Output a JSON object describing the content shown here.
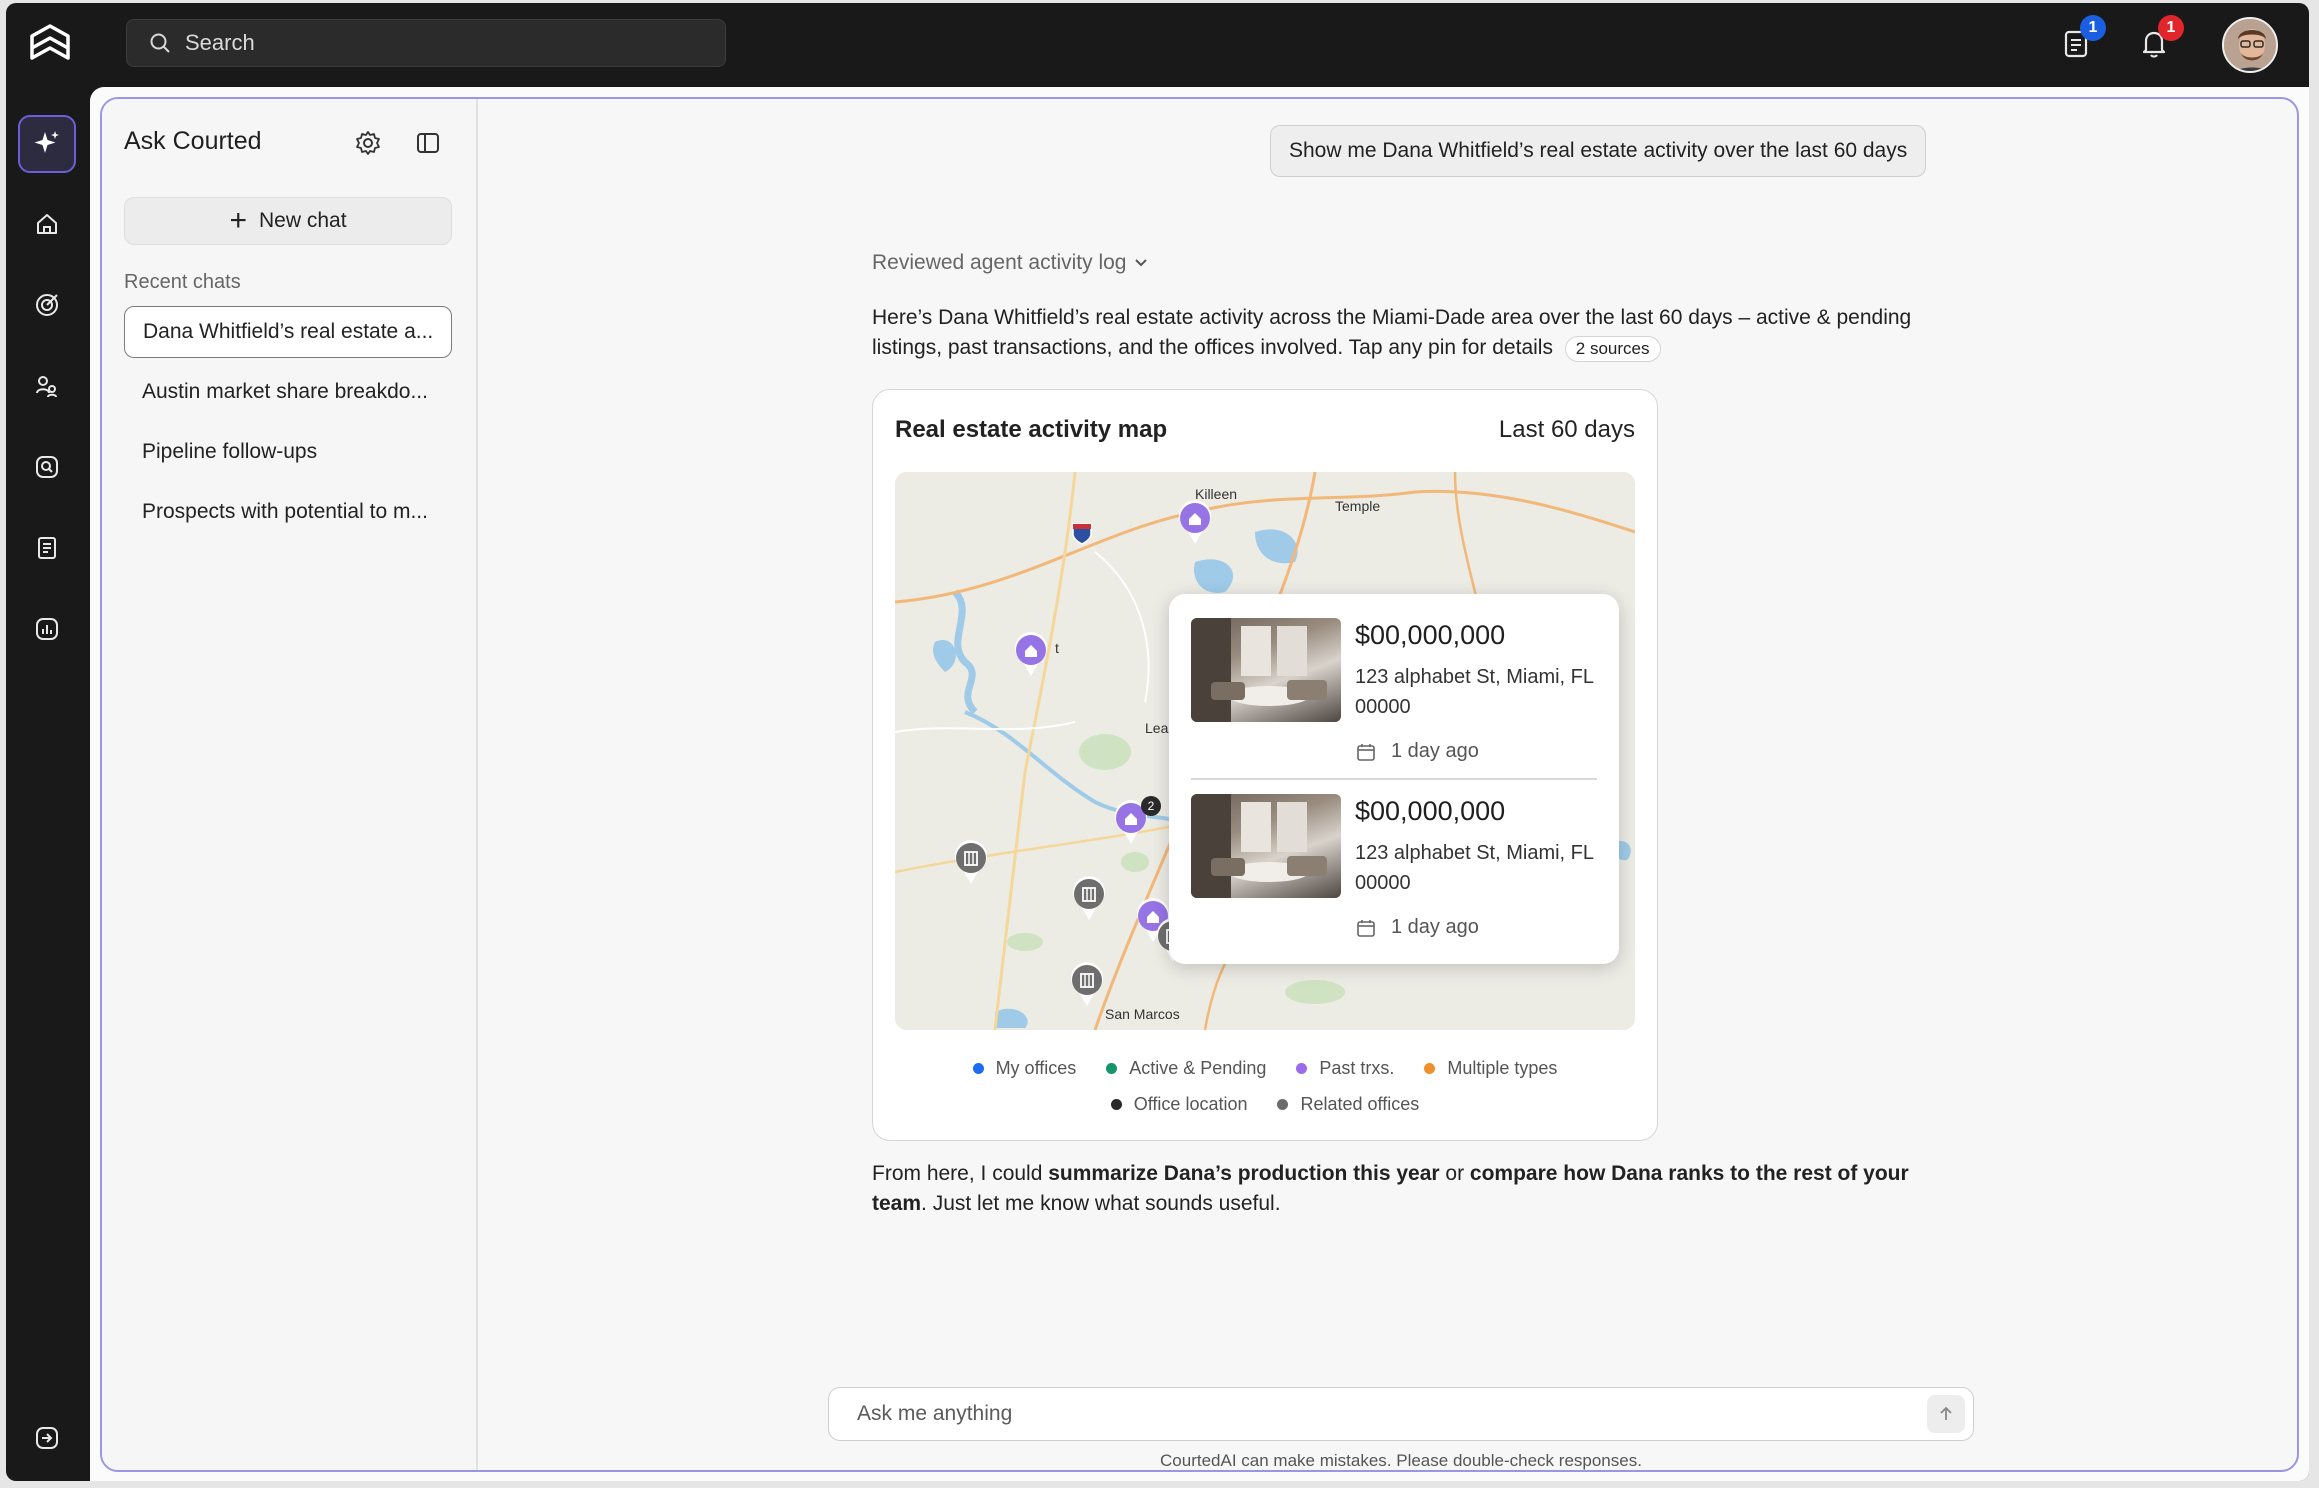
{
  "topbar": {
    "search_placeholder": "Search",
    "tasks_badge": "1",
    "notifications_badge": "1"
  },
  "sidebar": {
    "title": "Ask Courted",
    "new_chat": "New chat",
    "recent_label": "Recent chats",
    "chats": [
      "Dana Whitfield’s real estate a...",
      "Austin market share breakdo...",
      "Pipeline follow-ups",
      "Prospects with potential to m..."
    ]
  },
  "conversation": {
    "user_message": "Show me Dana Whitfield’s real estate activity over the last 60 days",
    "reviewed": "Reviewed agent activity log",
    "answer": "Here’s Dana Whitfield’s real estate activity across the Miami-Dade area over the last 60 days – active & pending listings, past transactions, and the offices involved. Tap any pin for details",
    "sources": "2 sources",
    "followup_pre": "From here, I could ",
    "followup_b1": "summarize Dana’s production this year",
    "followup_mid": " or ",
    "followup_b2": "compare how Dana ranks to the rest of your team",
    "followup_post": ". Just let me know what sounds useful."
  },
  "map_card": {
    "title": "Real estate activity map",
    "range": "Last 60 days",
    "places": [
      "Killeen",
      "Temple",
      "San Marcos",
      "Lea",
      "t"
    ],
    "cluster_count": "2",
    "listings": [
      {
        "price": "$00,000,000",
        "address": "123 alphabet St, Miami, FL 00000",
        "ago": "1 day ago"
      },
      {
        "price": "$00,000,000",
        "address": "123 alphabet St, Miami, FL 00000",
        "ago": "1 day ago"
      }
    ],
    "legend": [
      {
        "label": "My offices",
        "color": "#1b6cf0"
      },
      {
        "label": "Active & Pending",
        "color": "#17946b"
      },
      {
        "label": "Past trxs.",
        "color": "#9a6cec"
      },
      {
        "label": "Multiple types",
        "color": "#f0902a"
      },
      {
        "label": "Office location",
        "color": "#2a2a2a"
      },
      {
        "label": "Related offices",
        "color": "#6b6b6b"
      }
    ]
  },
  "composer": {
    "placeholder": "Ask me anything",
    "disclaimer": "CourtedAI can make mistakes. Please double-check responses."
  },
  "colors": {
    "accent_purple": "#8a6ae0",
    "past_pin": "#9674e6",
    "office_pin": "#6e6e6e"
  }
}
